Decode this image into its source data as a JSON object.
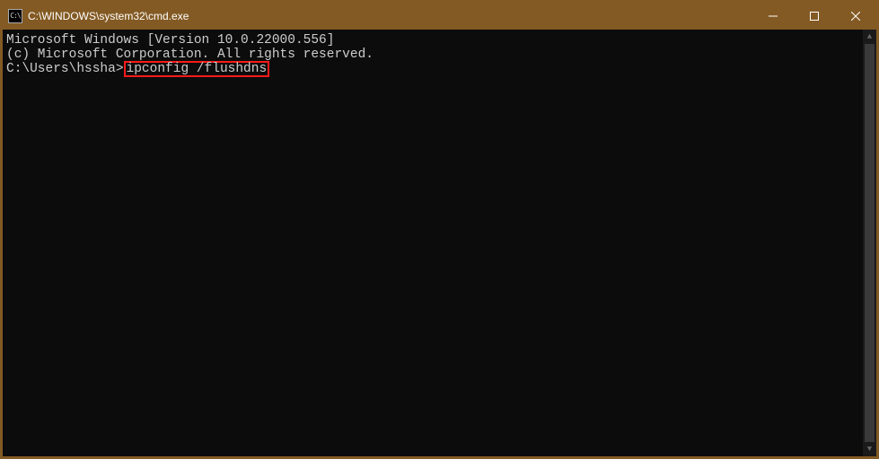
{
  "titlebar": {
    "icon_glyph": "C:\\",
    "title": "C:\\WINDOWS\\system32\\cmd.exe"
  },
  "terminal": {
    "line1": "Microsoft Windows [Version 10.0.22000.556]",
    "line2": "(c) Microsoft Corporation. All rights reserved.",
    "blank": "",
    "prompt": "C:\\Users\\hssha>",
    "command": "ipconfig /flushdns"
  }
}
